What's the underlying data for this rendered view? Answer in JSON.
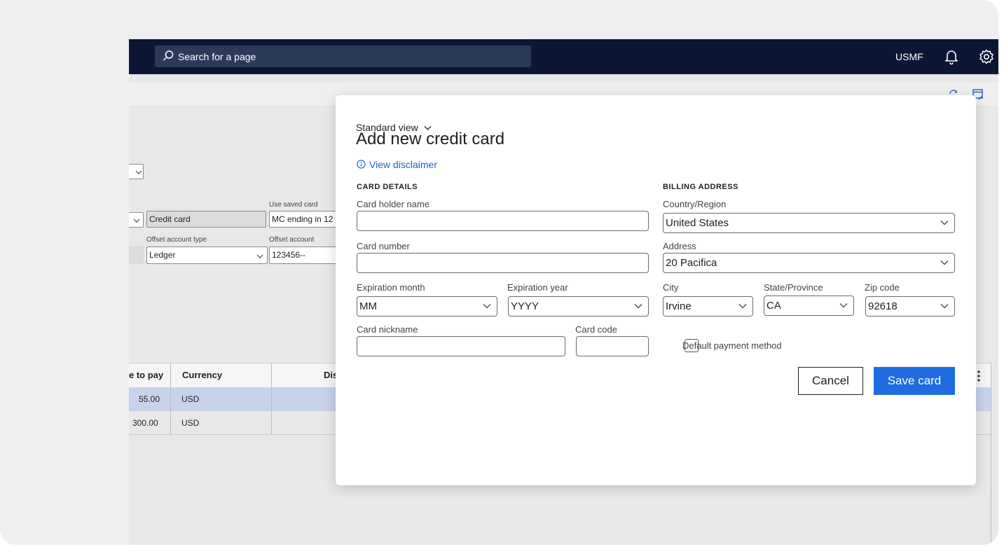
{
  "topbar": {
    "search_placeholder": "Search for a page",
    "company": "USMF",
    "icons": [
      "search-icon",
      "bell-icon",
      "gear-icon"
    ]
  },
  "background_form": {
    "method_value": "Credit card",
    "use_saved_card_label": "Use saved card",
    "use_saved_card_value": "MC ending in 12",
    "offset_account_type_label": "Offset account type",
    "offset_account_type_value": "Ledger",
    "offset_account_label": "Offset account",
    "offset_account_value": "123456--"
  },
  "grid": {
    "columns": [
      "e to pay",
      "Currency",
      "Dis"
    ],
    "rows": [
      {
        "amount": "55.00",
        "currency": "USD"
      },
      {
        "amount": "300.00",
        "currency": "USD"
      }
    ]
  },
  "dialog": {
    "view_selector": "Standard view",
    "title": "Add new credit card",
    "disclaimer_link": "View disclaimer",
    "card_details": {
      "heading": "CARD DETAILS",
      "holder_label": "Card holder name",
      "holder_value": "",
      "number_label": "Card number",
      "number_value": "",
      "exp_month_label": "Expiration month",
      "exp_month_value": "MM",
      "exp_year_label": "Expiration year",
      "exp_year_value": "YYYY",
      "nickname_label": "Card nickname",
      "nickname_value": "",
      "code_label": "Card code",
      "code_value": ""
    },
    "billing": {
      "heading": "BILLING ADDRESS",
      "country_label": "Country/Region",
      "country_value": "United States",
      "address_label": "Address",
      "address_value": "20 Pacifica",
      "city_label": "City",
      "city_value": "Irvine",
      "state_label": "State/Province",
      "state_value": "CA",
      "zip_label": "Zip code",
      "zip_value": "92618",
      "default_label": "Default payment method",
      "default_checked": false
    },
    "cancel_label": "Cancel",
    "save_label": "Save card",
    "accent_color": "#1f6be0",
    "link_color": "#1d62c5"
  }
}
